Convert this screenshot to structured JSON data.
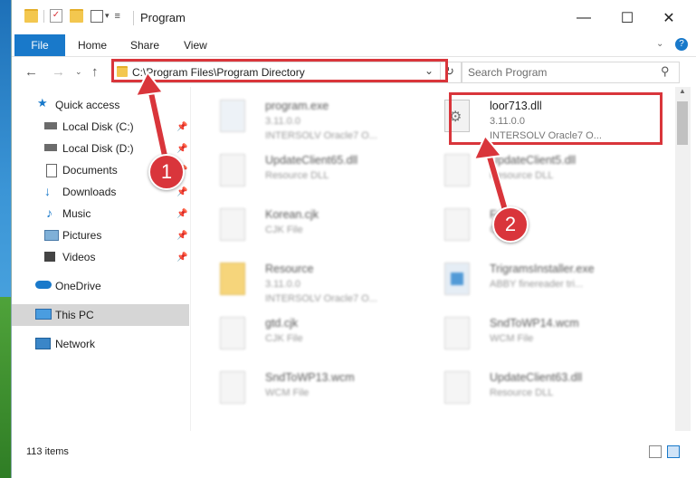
{
  "window": {
    "title": "Program",
    "controls": {
      "minimize": "—",
      "maximize": "☐",
      "close": "✕"
    }
  },
  "ribbon": {
    "tabs": [
      "File",
      "Home",
      "Share",
      "View"
    ],
    "help": "?"
  },
  "address": {
    "path": "C:\\Program Files\\Program Directory",
    "refresh": "↻",
    "dropdown": "⌄"
  },
  "search": {
    "placeholder": "Search Program"
  },
  "sidebar": {
    "items": [
      {
        "label": "Quick access",
        "icon": "star-icon"
      },
      {
        "label": "Local Disk (C:)",
        "icon": "drive-icon"
      },
      {
        "label": "Local Disk (D:)",
        "icon": "drive-icon"
      },
      {
        "label": "Documents",
        "icon": "documents-icon"
      },
      {
        "label": "Downloads",
        "icon": "download-icon"
      },
      {
        "label": "Music",
        "icon": "music-icon"
      },
      {
        "label": "Pictures",
        "icon": "pictures-icon"
      },
      {
        "label": "Videos",
        "icon": "videos-icon"
      },
      {
        "label": "OneDrive",
        "icon": "cloud-icon"
      },
      {
        "label": "This PC",
        "icon": "computer-icon"
      },
      {
        "label": "Network",
        "icon": "network-icon"
      }
    ]
  },
  "files": [
    {
      "name": "program.exe",
      "line2": "3.11.0.0",
      "line3": "INTERSOLV Oracle7 O..."
    },
    {
      "name": "loor713.dll",
      "line2": "3.11.0.0",
      "line3": "INTERSOLV Oracle7 O..."
    },
    {
      "name": "UpdateClient65.dll",
      "line2": "Resource DLL",
      "line3": ""
    },
    {
      "name": "UpdateClient5.dll",
      "line2": "Resource DLL",
      "line3": ""
    },
    {
      "name": "Korean.cjk",
      "line2": "CJK File",
      "line3": ""
    },
    {
      "name": "Fe...cjk",
      "line2": "CJ...",
      "line3": ""
    },
    {
      "name": "Resource",
      "line2": "3.11.0.0",
      "line3": "INTERSOLV Oracle7 O..."
    },
    {
      "name": "TrigramsInstaller.exe",
      "line2": "ABBY finereader tri...",
      "line3": ""
    },
    {
      "name": "gtd.cjk",
      "line2": "CJK File",
      "line3": ""
    },
    {
      "name": "SndToWP14.wcm",
      "line2": "WCM File",
      "line3": ""
    },
    {
      "name": "SndToWP13.wcm",
      "line2": "WCM File",
      "line3": ""
    },
    {
      "name": "UpdateClient63.dll",
      "line2": "Resource DLL",
      "line3": ""
    }
  ],
  "status": {
    "count": "113 items"
  },
  "callouts": {
    "one": "1",
    "two": "2"
  },
  "colors": {
    "accent": "#1979ca",
    "highlight": "#d9353b"
  }
}
